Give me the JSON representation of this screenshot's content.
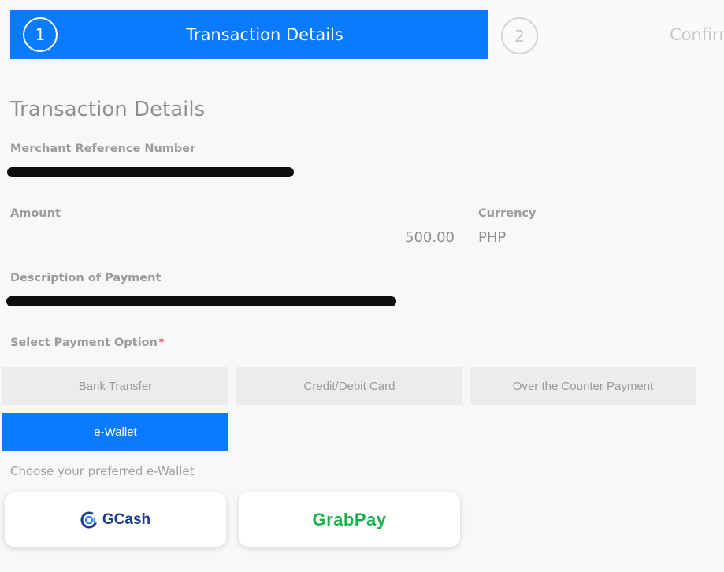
{
  "stepper": {
    "steps": [
      {
        "number": "1",
        "label": "Transaction Details"
      },
      {
        "number": "2",
        "label": "Confirm"
      }
    ]
  },
  "form": {
    "title": "Transaction Details",
    "merchant_ref_label": "Merchant Reference Number",
    "amount_label": "Amount",
    "amount_value": "500.00",
    "currency_label": "Currency",
    "currency_value": "PHP",
    "description_label": "Description of Payment",
    "payment_option_label": "Select Payment Option",
    "required_marker": "*"
  },
  "payment_options": [
    {
      "label": "Bank Transfer",
      "selected": false
    },
    {
      "label": "Credit/Debit Card",
      "selected": false
    },
    {
      "label": "Over the Counter Payment",
      "selected": false
    },
    {
      "label": "e-Wallet",
      "selected": true
    }
  ],
  "ewallet": {
    "hint": "Choose your preferred e-Wallet",
    "options": [
      {
        "label": "GCash",
        "icon": "gcash-logo-icon"
      },
      {
        "label": "GrabPay",
        "icon": "grabpay-logo"
      }
    ]
  },
  "colors": {
    "accent": "#0a7bff",
    "gcash": "#1a3a8f",
    "grabpay": "#18b14b"
  }
}
